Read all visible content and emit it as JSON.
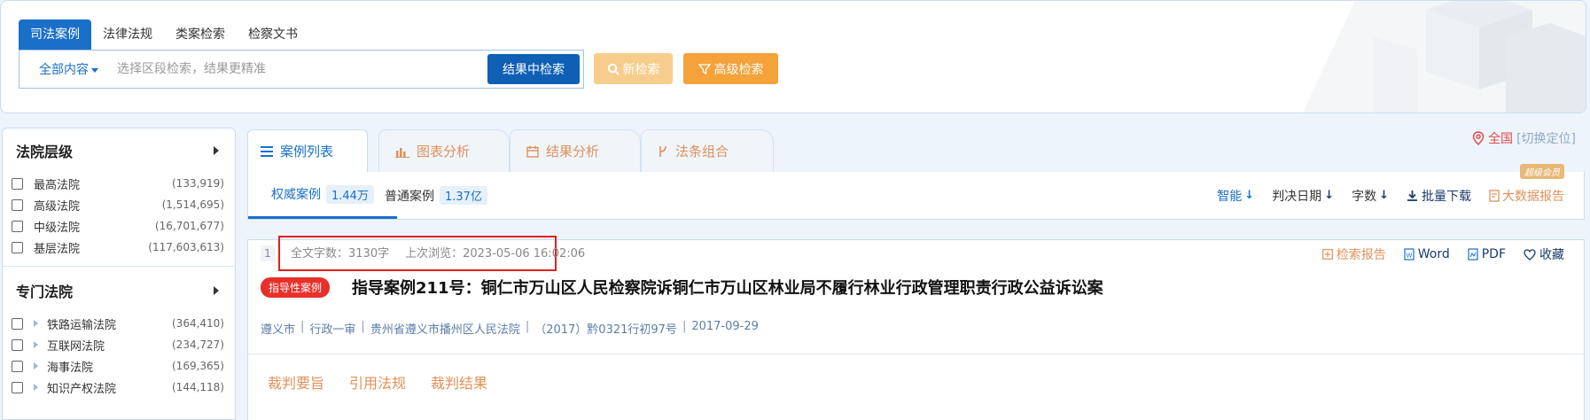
{
  "top": {
    "tabs": [
      "司法案例",
      "法律法规",
      "类案检索",
      "检察文书"
    ],
    "scope_label": "全部内容",
    "search_placeholder": "选择区段检索，结果更精准",
    "btn_in_result": "结果中检索",
    "btn_new": "新检索",
    "btn_advanced": "高级检索"
  },
  "filters": {
    "groups": [
      {
        "title": "法院层级",
        "items": [
          {
            "label": "最高法院",
            "count": "(133,919)"
          },
          {
            "label": "高级法院",
            "count": "(1,514,695)"
          },
          {
            "label": "中级法院",
            "count": "(16,701,677)"
          },
          {
            "label": "基层法院",
            "count": "(117,603,613)"
          }
        ]
      },
      {
        "title": "专门法院",
        "items": [
          {
            "label": "铁路运输法院",
            "count": "(364,410)"
          },
          {
            "label": "互联网法院",
            "count": "(234,727)"
          },
          {
            "label": "海事法院",
            "count": "(169,365)"
          },
          {
            "label": "知识产权法院",
            "count": "(144,118)"
          }
        ]
      }
    ]
  },
  "view_tabs": [
    "案例列表",
    "图表分析",
    "结果分析",
    "法条组合"
  ],
  "location": {
    "name": "全国",
    "switch": "[切换定位]"
  },
  "sub_tabs": [
    {
      "label": "权威案例",
      "num": "1.44万"
    },
    {
      "label": "普通案例",
      "num": "1.37亿"
    }
  ],
  "sort": {
    "smart": "智能",
    "date": "判决日期",
    "words": "字数",
    "batch": "批量下载",
    "bigdata": "大数据报告",
    "vip": "超级会员"
  },
  "result": {
    "index": "1",
    "word_count": "全文字数：3130字",
    "last_view": "上次浏览：2023-05-06 16:02:06",
    "actions": {
      "report": "检索报告",
      "word": "Word",
      "pdf": "PDF",
      "fav": "收藏"
    },
    "tag": "指导性案例",
    "title": "指导案例211号：铜仁市万山区人民检察院诉铜仁市万山区林业局不履行林业行政管理职责行政公益诉讼案",
    "meta": [
      "遵义市",
      "行政一审",
      "贵州省遵义市播州区人民法院",
      "（2017）黔0321行初97号",
      "2017-09-29"
    ],
    "links": [
      "裁判要旨",
      "引用法规",
      "裁判结果"
    ]
  },
  "colors": {
    "primary": "#1a6fc9",
    "orange": "#f5a23a",
    "red": "#e8302b"
  }
}
